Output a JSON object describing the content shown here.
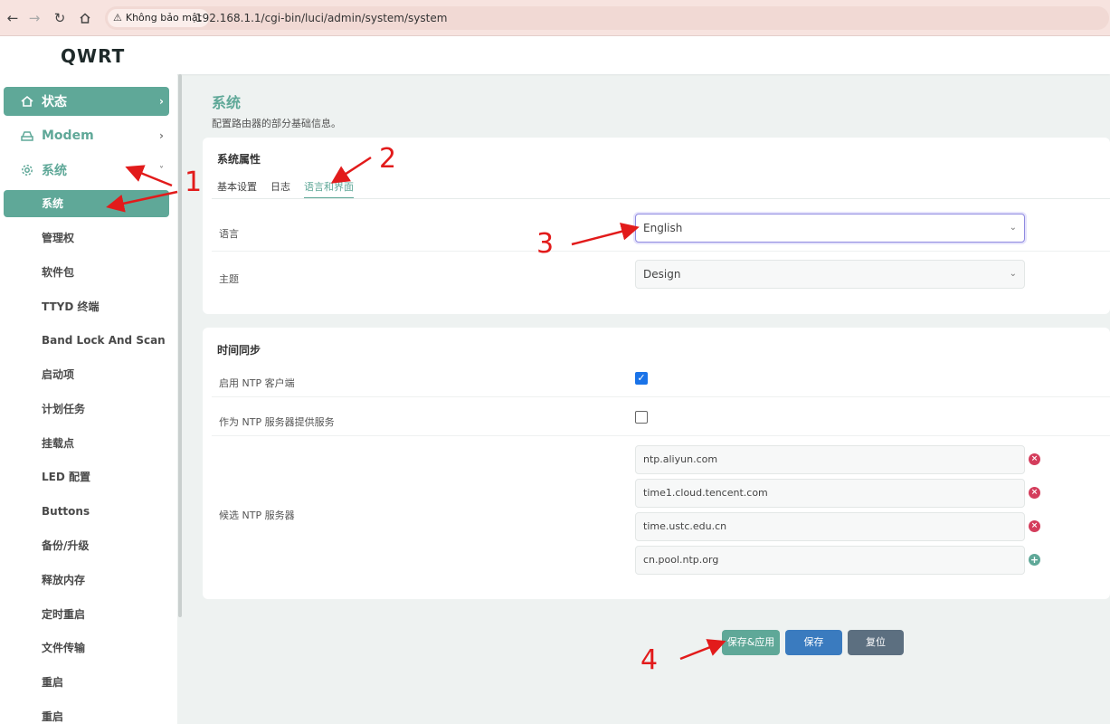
{
  "browser": {
    "security_label": "Không bảo mật",
    "url": "192.168.1.1/cgi-bin/luci/admin/system/system"
  },
  "header": {
    "brand": "QWRT"
  },
  "sidebar": {
    "top_items": [
      {
        "label": "状态",
        "icon": "home-icon",
        "active": true
      },
      {
        "label": "Modem",
        "icon": "modem-icon",
        "active": false
      },
      {
        "label": "系统",
        "icon": "gear-icon",
        "active": false,
        "expanded": true
      }
    ],
    "sub_items": [
      {
        "label": "系统",
        "active": true
      },
      {
        "label": "管理权"
      },
      {
        "label": "软件包"
      },
      {
        "label": "TTYD 终端"
      },
      {
        "label": "Band Lock And Scan"
      },
      {
        "label": "启动项"
      },
      {
        "label": "计划任务"
      },
      {
        "label": "挂载点"
      },
      {
        "label": "LED 配置"
      },
      {
        "label": "Buttons"
      },
      {
        "label": "备份/升级"
      },
      {
        "label": "释放内存"
      },
      {
        "label": "定时重启"
      },
      {
        "label": "文件传输"
      },
      {
        "label": "重启"
      },
      {
        "label": "重启"
      }
    ]
  },
  "main": {
    "title": "系统",
    "description": "配置路由器的部分基础信息。",
    "properties": {
      "title": "系统属性",
      "tabs": [
        {
          "label": "基本设置"
        },
        {
          "label": "日志"
        },
        {
          "label": "语言和界面",
          "active": true
        }
      ],
      "language_label": "语言",
      "language_value": "English",
      "theme_label": "主题",
      "theme_value": "Design"
    },
    "timesync": {
      "title": "时间同步",
      "ntp_client_label": "启用 NTP 客户端",
      "ntp_client_checked": true,
      "ntp_server_label": "作为 NTP 服务器提供服务",
      "ntp_server_checked": false,
      "candidates_label": "候选 NTP 服务器",
      "servers": [
        "ntp.aliyun.com",
        "time1.cloud.tencent.com",
        "time.ustc.edu.cn",
        "cn.pool.ntp.org"
      ]
    },
    "actions": {
      "save_apply": "保存&应用",
      "save": "保存",
      "reset": "复位"
    }
  },
  "annotations": [
    "1",
    "2",
    "3",
    "4"
  ],
  "colors": {
    "accent": "#5fa898",
    "save_blue": "#3a7bbf",
    "reset_gray": "#5c6f80",
    "remove_red": "#d43d5c",
    "annotation_red": "#e21b1b"
  }
}
